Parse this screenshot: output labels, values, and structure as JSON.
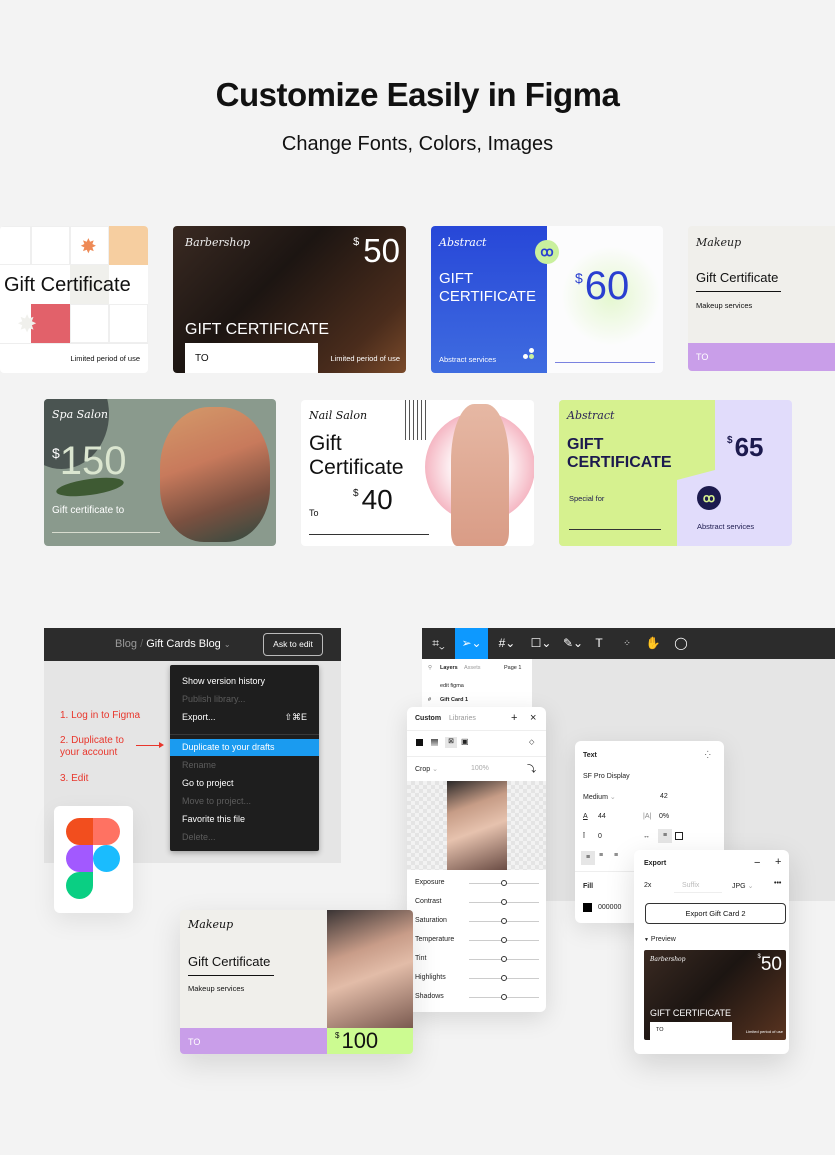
{
  "header": {
    "title": "Customize Easily in Figma",
    "subtitle": "Change Fonts, Colors, Images"
  },
  "cards": [
    {
      "id": "grid",
      "title": "Gift Certificate",
      "note": "Limited period of use"
    },
    {
      "id": "barbershop",
      "brand": "Barbershop",
      "currency": "$",
      "amount": "50",
      "title": "GIFT CERTIFICATE",
      "to": "TO",
      "note": "Limited period of use"
    },
    {
      "id": "abstract-blue",
      "brand": "Abstract",
      "title_line1": "GIFT",
      "title_line2": "CERTIFICATE",
      "services": "Abstract services",
      "currency": "$",
      "amount": "60",
      "badge_icon": "ribbon-icon"
    },
    {
      "id": "makeup",
      "brand": "Makeup",
      "title": "Gift Certificate",
      "services": "Makeup services",
      "to": "TO"
    },
    {
      "id": "spa",
      "brand": "Spa Salon",
      "currency": "$",
      "amount": "150",
      "caption": "Gift certificate to"
    },
    {
      "id": "nail",
      "brand": "Nail Salon",
      "title_line1": "Gift",
      "title_line2": "Certificate",
      "currency": "$",
      "amount": "40",
      "to": "To"
    },
    {
      "id": "abstract-green",
      "brand": "Abstract",
      "title_line1": "GIFT",
      "title_line2": "CERTIFICATE",
      "special": "Special for",
      "currency": "$",
      "amount": "65",
      "services": "Abstract services",
      "badge_icon": "ribbon-icon"
    },
    {
      "id": "makeup-100",
      "brand": "Makeup",
      "title": "Gift Certificate",
      "services": "Makeup services",
      "to": "TO",
      "currency": "$",
      "amount": "100"
    }
  ],
  "file_menu": {
    "breadcrumb_parent": "Blog",
    "breadcrumb_sep": "/",
    "breadcrumb_current": "Gift Cards Blog",
    "ask_button": "Ask to edit",
    "items": [
      {
        "label": "Show version history",
        "state": "enabled"
      },
      {
        "label": "Publish library...",
        "state": "disabled"
      },
      {
        "label": "Export...",
        "shortcut": "⇧⌘E",
        "state": "enabled"
      },
      {
        "label": "Duplicate to your drafts",
        "state": "active"
      },
      {
        "label": "Rename",
        "state": "disabled"
      },
      {
        "label": "Go to project",
        "state": "enabled"
      },
      {
        "label": "Move to project...",
        "state": "disabled"
      },
      {
        "label": "Favorite this file",
        "state": "enabled"
      },
      {
        "label": "Delete...",
        "state": "disabled"
      }
    ]
  },
  "steps": [
    "1. Log in to Figma",
    "2. Duplicate to your account",
    "3. Edit"
  ],
  "editor": {
    "toolbar": [
      "figma-menu-icon",
      "move-tool-icon",
      "frame-tool-icon",
      "rectangle-tool-icon",
      "pen-tool-icon",
      "text-tool-icon",
      "resources-icon",
      "hand-tool-icon",
      "comment-icon"
    ],
    "layers_tab": "Layers",
    "assets_tab": "Assets",
    "page": "Page 1",
    "layer_items": [
      "edit figma",
      "Gift Card 1"
    ]
  },
  "image_panel": {
    "tab_custom": "Custom",
    "tab_libraries": "Libraries",
    "mode": "Crop",
    "opacity": "100%",
    "adjustments": [
      {
        "label": "Exposure",
        "value": 0.5
      },
      {
        "label": "Contrast",
        "value": 0.5
      },
      {
        "label": "Saturation",
        "value": 0.5
      },
      {
        "label": "Temperature",
        "value": 0.5
      },
      {
        "label": "Tint",
        "value": 0.5
      },
      {
        "label": "Highlights",
        "value": 0.5
      },
      {
        "label": "Shadows",
        "value": 0.5
      }
    ]
  },
  "text_panel": {
    "title": "Text",
    "font": "SF Pro Display",
    "weight": "Medium",
    "size": "42",
    "line_height": "44",
    "letter_spacing": "0%",
    "paragraph_spacing": "0",
    "fill_label": "Fill",
    "fill_hex": "000000",
    "fill_color": "#000000"
  },
  "export_panel": {
    "title": "Export",
    "scale": "2x",
    "suffix_placeholder": "Suffix",
    "format": "JPG",
    "button": "Export Gift Card 2",
    "preview_label": "Preview",
    "preview": {
      "brand": "Barbershop",
      "currency": "$",
      "amount": "50",
      "title": "GIFT CERTIFICATE",
      "to": "TO",
      "note": "Limited period of use"
    }
  },
  "colors": {
    "figma_blue": "#0d99ff",
    "menu_active": "#1a9bf0",
    "step_red": "#e8362c",
    "lilac": "#c99ee9",
    "lime": "#ccfb91"
  }
}
